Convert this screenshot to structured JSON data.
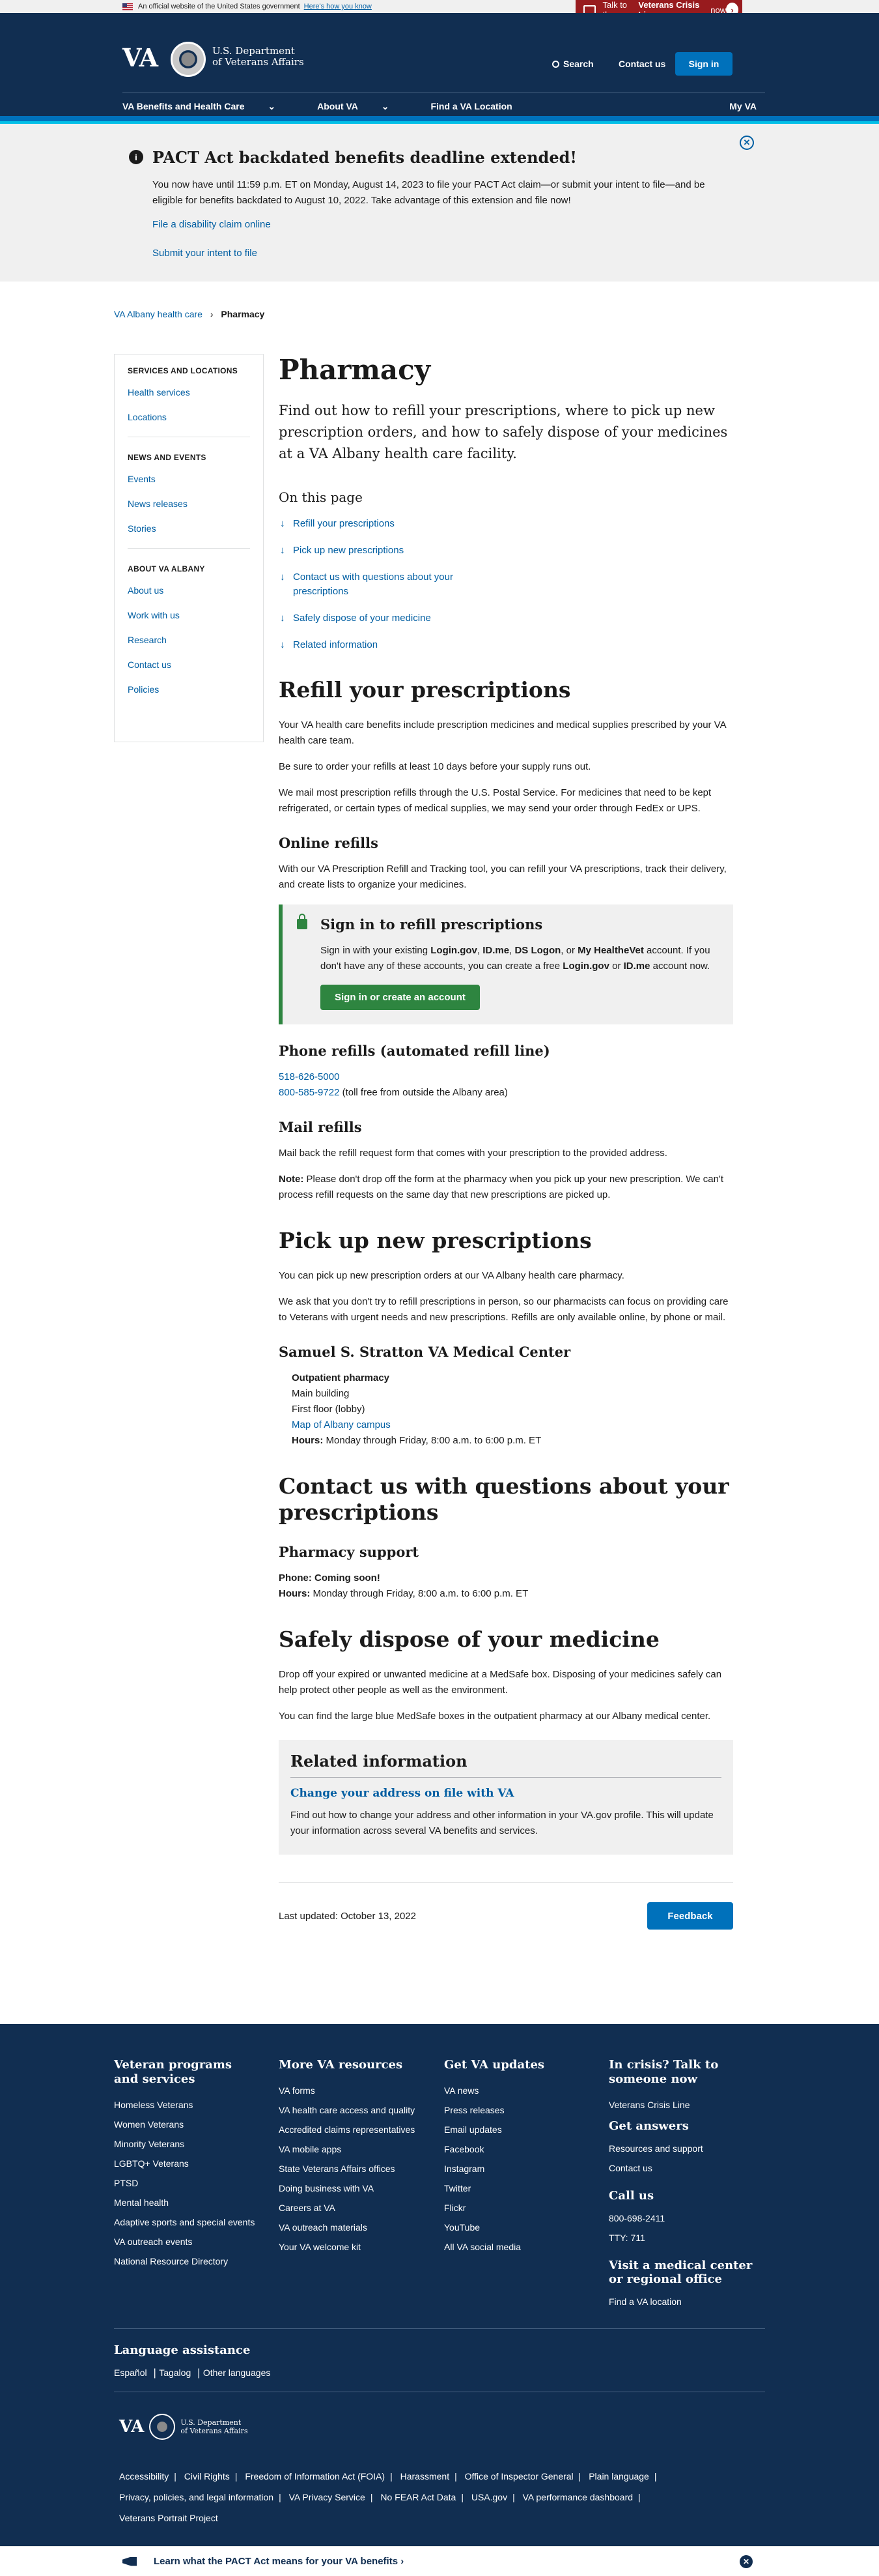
{
  "official_banner": {
    "text": "An official website of the United States government",
    "link": "Here's how you know"
  },
  "crisis_line": {
    "pre": "Talk to the",
    "bold": "Veterans Crisis Line",
    "post": "now"
  },
  "header": {
    "logo_text": "VA",
    "dept_line1": "U.S. Department",
    "dept_line2": "of Veterans Affairs",
    "search_label": "Search",
    "contact_label": "Contact us",
    "signin_label": "Sign in",
    "nav": {
      "benefits": "VA Benefits and Health Care",
      "about": "About VA",
      "find": "Find a VA Location",
      "myva": "My VA"
    }
  },
  "alert": {
    "title": "PACT Act backdated benefits deadline extended!",
    "body": "You now have until 11:59 p.m. ET on Monday, August 14, 2023 to file your PACT Act claim—or submit your intent to file—and be eligible for benefits backdated to August 10, 2022. Take advantage of this extension and file now!",
    "link1": "File a disability claim online",
    "link2": "Submit your intent to file"
  },
  "breadcrumb": {
    "parent": "VA Albany health care",
    "current": "Pharmacy"
  },
  "sidebar": {
    "section1": "SERVICES AND LOCATIONS",
    "s1_items": [
      "Health services",
      "Locations"
    ],
    "section2": "NEWS AND EVENTS",
    "s2_items": [
      "Events",
      "News releases",
      "Stories"
    ],
    "section3": "ABOUT VA ALBANY",
    "s3_items": [
      "About us",
      "Work with us",
      "Research",
      "Contact us",
      "Policies"
    ]
  },
  "main": {
    "title": "Pharmacy",
    "lede": "Find out how to refill your prescriptions, where to pick up new prescription orders, and how to safely dispose of your medicines at a VA Albany health care facility.",
    "otp_title": "On this page",
    "otp": [
      "Refill your prescriptions",
      "Pick up new prescriptions",
      "Contact us with questions about your prescriptions",
      "Safely dispose of your medicine",
      "Related information"
    ],
    "refill": {
      "heading": "Refill your prescriptions",
      "p1": "Your VA health care benefits include prescription medicines and medical supplies prescribed by your VA health care team.",
      "p2": "Be sure to order your refills at least 10 days before your supply runs out.",
      "p3": "We mail most prescription refills through the U.S. Postal Service. For medicines that need to be kept refrigerated, or certain types of medical supplies, we may send your order through FedEx or UPS.",
      "online_heading": "Online refills",
      "online_p": "With our VA Prescription Refill and Tracking tool, you can refill your VA prescriptions, track their delivery, and create lists to organize your medicines.",
      "signin_title": "Sign in to refill prescriptions",
      "signin_t1": "Sign in with your existing ",
      "signin_b1": "Login.gov",
      "signin_t2": ", ",
      "signin_b2": "ID.me",
      "signin_t3": ", ",
      "signin_b3": "DS Logon",
      "signin_t4": ", or ",
      "signin_b4": "My HealtheVet",
      "signin_t5": " account. If you don't have any of these accounts, you can create a free ",
      "signin_b5": "Login.gov",
      "signin_t6": " or ",
      "signin_b6": "ID.me",
      "signin_t7": " account now.",
      "signin_button": "Sign in or create an account",
      "phone_heading": "Phone refills (automated refill line)",
      "phone1": "518-626-5000",
      "phone2": "800-585-9722",
      "phone2_note": " (toll free from outside the Albany area)",
      "mail_heading": "Mail refills",
      "mail_p": "Mail back the refill request form that comes with your prescription to the provided address.",
      "note_label": "Note:",
      "note_text": " Please don't drop off the form at the pharmacy when you pick up your new prescription. We can't process refill requests on the same day that new prescriptions are picked up."
    },
    "pickup": {
      "heading": "Pick up new prescriptions",
      "p1": "You can pick up new prescription orders at our VA Albany health care pharmacy.",
      "p2": "We ask that you don't try to refill prescriptions in person, so our pharmacists can focus on providing care to Veterans with urgent needs and new prescriptions. Refills are only available online, by phone or mail.",
      "center": "Samuel S. Stratton VA Medical Center",
      "loc_name": "Outpatient pharmacy",
      "loc_building": "Main building",
      "loc_floor": "First floor (lobby)",
      "loc_map": "Map of Albany campus",
      "hours_label": "Hours:",
      "hours_text": " Monday through Friday, 8:00 a.m. to 6:00 p.m. ET"
    },
    "contact": {
      "heading": "Contact us with questions about your prescriptions",
      "sub": "Pharmacy support",
      "phone_label": "Phone:",
      "phone_text": " Coming soon!",
      "hours_label": "Hours:",
      "hours_text": " Monday through Friday, 8:00 a.m. to 6:00 p.m. ET"
    },
    "dispose": {
      "heading": "Safely dispose of your medicine",
      "p1": "Drop off your expired or unwanted medicine at a MedSafe box. Disposing of your medicines safely can help protect other people as well as the environment.",
      "p2": "You can find the large blue MedSafe boxes in the outpatient pharmacy at our Albany medical center."
    },
    "related": {
      "heading": "Related information",
      "link": "Change your address on file with VA",
      "p": "Find out how to change your address and other information in your VA.gov profile. This will update your information across several VA benefits and services."
    },
    "last_updated": "Last updated: October 13, 2022",
    "feedback": "Feedback"
  },
  "footer": {
    "col1": {
      "title": "Veteran programs and services",
      "links": [
        "Homeless Veterans",
        "Women Veterans",
        "Minority Veterans",
        "LGBTQ+ Veterans",
        "PTSD",
        "Mental health",
        "Adaptive sports and special events",
        "VA outreach events",
        "National Resource Directory"
      ]
    },
    "col2": {
      "title": "More VA resources",
      "links": [
        "VA forms",
        "VA health care access and quality",
        "Accredited claims representatives",
        "VA mobile apps",
        "State Veterans Affairs offices",
        "Doing business with VA",
        "Careers at VA",
        "VA outreach materials",
        "Your VA welcome kit"
      ]
    },
    "col3": {
      "title": "Get VA updates",
      "links": [
        "VA news",
        "Press releases",
        "Email updates",
        "Facebook",
        "Instagram",
        "Twitter",
        "Flickr",
        "YouTube",
        "All VA social media"
      ]
    },
    "col4": {
      "title": "In crisis? Talk to someone now",
      "crisis_link": "Veterans Crisis Line",
      "answers_title": "Get answers",
      "answers": [
        "Resources and support",
        "Contact us"
      ],
      "call_title": "Call us",
      "calls": [
        "800-698-2411",
        "TTY: 711"
      ],
      "visit_title": "Visit a medical center or regional office",
      "visit_link": "Find a VA location"
    },
    "language": {
      "title": "Language assistance",
      "links": [
        "Español",
        "Tagalog",
        "Other languages"
      ]
    },
    "logo_text": "VA",
    "dept_line1": "U.S. Department",
    "dept_line2": "of Veterans Affairs",
    "bottom_links": [
      "Accessibility",
      "Civil Rights",
      "Freedom of Information Act (FOIA)",
      "Harassment",
      "Office of Inspector General",
      "Plain language",
      "Privacy, policies, and legal information",
      "VA Privacy Service",
      "No FEAR Act Data",
      "USA.gov",
      "VA performance dashboard",
      "Veterans Portrait Project"
    ]
  },
  "pact_banner": {
    "text": "Learn what the PACT Act means for your VA benefits ›"
  }
}
